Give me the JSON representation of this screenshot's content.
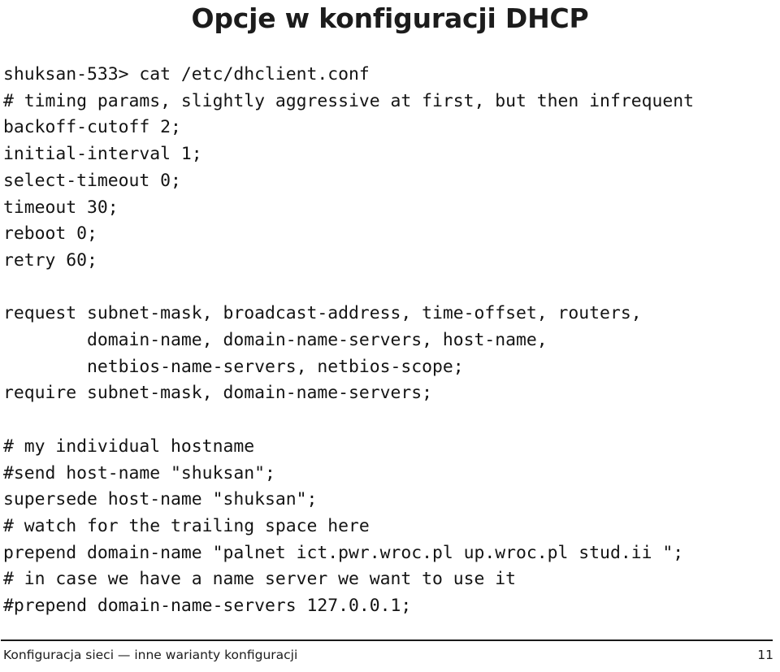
{
  "slide": {
    "title": "Opcje w konfiguracji DHCP",
    "page_number": "11",
    "background_color": "#ffffff",
    "text_color": "#1a1a1a"
  },
  "terminal": {
    "prompt_line": "shuksan-533> cat /etc/dhclient.conf",
    "lines": [
      "shuksan-533> cat /etc/dhclient.conf",
      "# timing params, slightly aggressive at first, but then infrequent",
      "backoff-cutoff 2;",
      "initial-interval 1;",
      "select-timeout 0;",
      "timeout 30;",
      "reboot 0;",
      "retry 60;",
      "",
      "request subnet-mask, broadcast-address, time-offset, routers,",
      "        domain-name, domain-name-servers, host-name,",
      "        netbios-name-servers, netbios-scope;",
      "require subnet-mask, domain-name-servers;",
      "",
      "# my individual hostname",
      "#send host-name \"shuksan\";",
      "supersede host-name \"shuksan\";",
      "# watch for the trailing space here",
      "prepend domain-name \"palnet ict.pwr.wroc.pl up.wroc.pl stud.ii \";",
      "# in case we have a name server we want to use it",
      "#prepend domain-name-servers 127.0.0.1;"
    ]
  },
  "footer": {
    "left_text": "Konfiguracja sieci — inne warianty konfiguracji",
    "right_text": "11"
  }
}
